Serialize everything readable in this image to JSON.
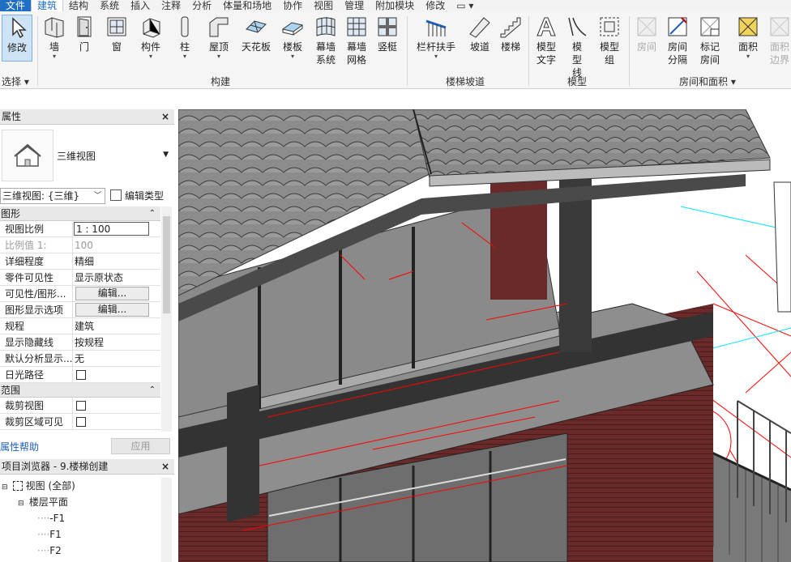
{
  "menu": {
    "tabs": [
      "文件",
      "建筑",
      "结构",
      "系统",
      "插入",
      "注释",
      "分析",
      "体量和场地",
      "协作",
      "视图",
      "管理",
      "附加模块",
      "修改"
    ],
    "active": "建筑",
    "extra": "▭ ▾"
  },
  "ribbon": {
    "modify": {
      "label": "修改",
      "group": "选择 ▾"
    },
    "build": [
      "墙",
      "门",
      "窗",
      "构件",
      "柱",
      "屋顶",
      "天花板",
      "楼板",
      "幕墙系统",
      "幕墙网格",
      "竖梃"
    ],
    "build_group": "构建",
    "stairs": [
      "栏杆扶手",
      "坡道",
      "楼梯"
    ],
    "stairs_group": "楼梯坡道",
    "model": [
      "模型文字",
      "模型线",
      "模型组"
    ],
    "model_group": "模型",
    "room": [
      "房间",
      "房间分隔",
      "标记房间",
      "面积",
      "面积边界"
    ],
    "room_group": "房间和面积 ▾"
  },
  "properties": {
    "title": "属性",
    "close": "×",
    "type_name": "三维视图",
    "instance": "三维视图: {三维}",
    "edit_type": "编辑类型",
    "sections": {
      "graphics": "图形",
      "extents": "范围"
    },
    "rows": [
      {
        "k": "视图比例",
        "v": "1 : 100"
      },
      {
        "k": "比例值 1:",
        "v": "100"
      },
      {
        "k": "详细程度",
        "v": "精细"
      },
      {
        "k": "零件可见性",
        "v": "显示原状态"
      },
      {
        "k": "可见性/图形...",
        "v": "编辑..."
      },
      {
        "k": "图形显示选项",
        "v": "编辑..."
      },
      {
        "k": "规程",
        "v": "建筑"
      },
      {
        "k": "显示隐藏线",
        "v": "按规程"
      },
      {
        "k": "默认分析显示...",
        "v": "无"
      },
      {
        "k": "日光路径",
        "v": ""
      }
    ],
    "rows2": [
      {
        "k": "裁剪视图",
        "v": ""
      },
      {
        "k": "裁剪区域可见",
        "v": ""
      }
    ],
    "help": "属性帮助",
    "apply": "应用"
  },
  "browser": {
    "title": "项目浏览器 - 9.楼梯创建",
    "close": "×",
    "nodes": [
      "视图 (全部)",
      "楼层平面",
      "-F1",
      "F1",
      "F2"
    ]
  },
  "colors": {
    "accent": "#1f6fc5",
    "roof": "#8a8a8a",
    "wall": "#6b2a2a",
    "cad_red": "#ff0000",
    "cad_cyan": "#00e5ff",
    "cad_green": "#00c040"
  }
}
